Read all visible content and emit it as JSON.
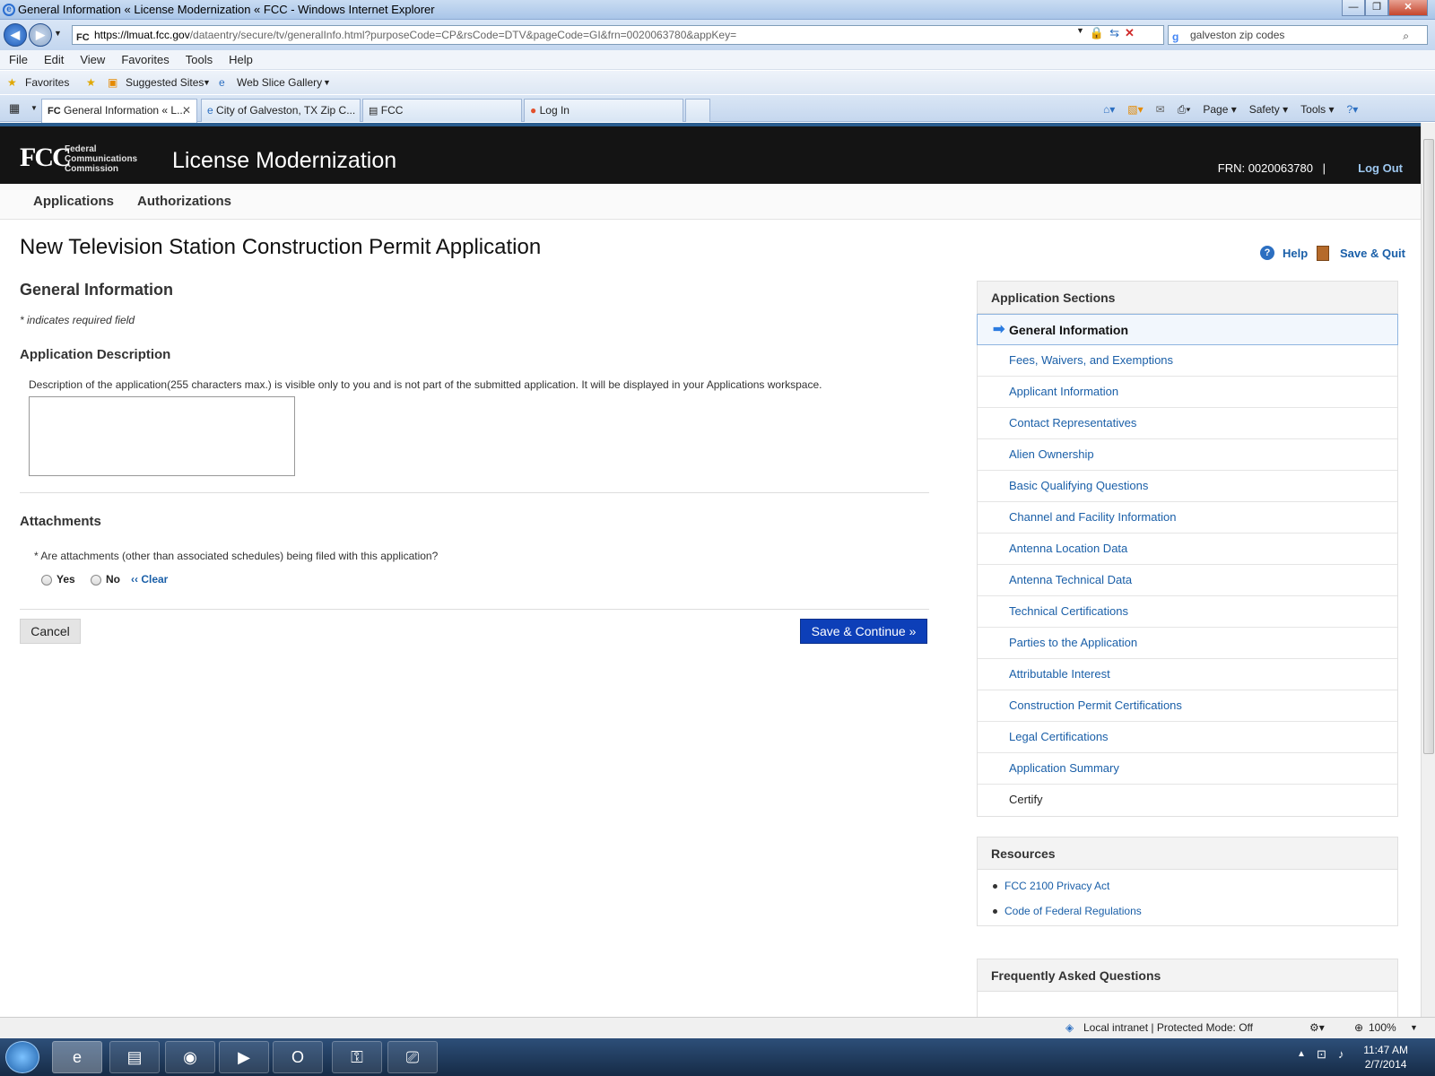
{
  "window": {
    "title": "General Information « License Modernization « FCC - Windows Internet Explorer"
  },
  "address": {
    "url_host": "https://lmuat.fcc.gov",
    "url_path": "/dataentry/secure/tv/generalInfo.html?purposeCode=CP&rsCode=DTV&pageCode=GI&frn=0020063780&appKey=",
    "search_value": "galveston zip codes"
  },
  "menu": [
    "File",
    "Edit",
    "View",
    "Favorites",
    "Tools",
    "Help"
  ],
  "favorites_bar": {
    "favorites": "Favorites",
    "suggested": "Suggested Sites",
    "webslice": "Web Slice Gallery"
  },
  "tabs": [
    {
      "label": "General Information « L..."
    },
    {
      "label": "City of Galveston, TX Zip C..."
    },
    {
      "label": "FCC"
    },
    {
      "label": "Log In"
    }
  ],
  "tab_tools": {
    "page": "Page",
    "safety": "Safety",
    "tools": "Tools"
  },
  "header": {
    "logo": "FCC",
    "agency_line1": "Federal",
    "agency_line2": "Communications",
    "agency_line3": "Commission",
    "app_title": "License Modernization",
    "frn": "FRN: 0020063780",
    "separator": "|",
    "logout": "Log Out"
  },
  "topnav": {
    "applications": "Applications",
    "authorizations": "Authorizations"
  },
  "main": {
    "page_title": "New Television Station Construction Permit Application",
    "help": "Help",
    "save_quit": "Save & Quit",
    "section_title": "General Information",
    "required_note": "* indicates required field",
    "app_desc_title": "Application Description",
    "app_desc_text": "Description of the application(255 characters max.) is visible only to you and is not part of the submitted application. It will be displayed in your Applications workspace.",
    "attachments_title": "Attachments",
    "attachments_question": "* Are attachments (other than associated schedules) being filed with this application?",
    "yes": "Yes",
    "no": "No",
    "clear": "‹‹ Clear",
    "cancel": "Cancel",
    "save_continue": "Save & Continue »"
  },
  "sidebar": {
    "sections_title": "Application Sections",
    "sections": [
      "General Information",
      "Fees, Waivers, and Exemptions",
      "Applicant Information",
      "Contact Representatives",
      "Alien Ownership",
      "Basic Qualifying Questions",
      "Channel and Facility Information",
      "Antenna Location Data",
      "Antenna Technical Data",
      "Technical Certifications",
      "Parties to the Application",
      "Attributable Interest",
      "Construction Permit Certifications",
      "Legal Certifications",
      "Application Summary",
      "Certify"
    ],
    "resources_title": "Resources",
    "resources": [
      "FCC 2100 Privacy Act",
      "Code of Federal Regulations"
    ],
    "faq_title": "Frequently Asked Questions"
  },
  "statusbar": {
    "zone": "Local intranet | Protected Mode: Off",
    "zoom": "100%"
  },
  "taskbar": {
    "time": "11:47 AM",
    "date": "2/7/2014"
  }
}
